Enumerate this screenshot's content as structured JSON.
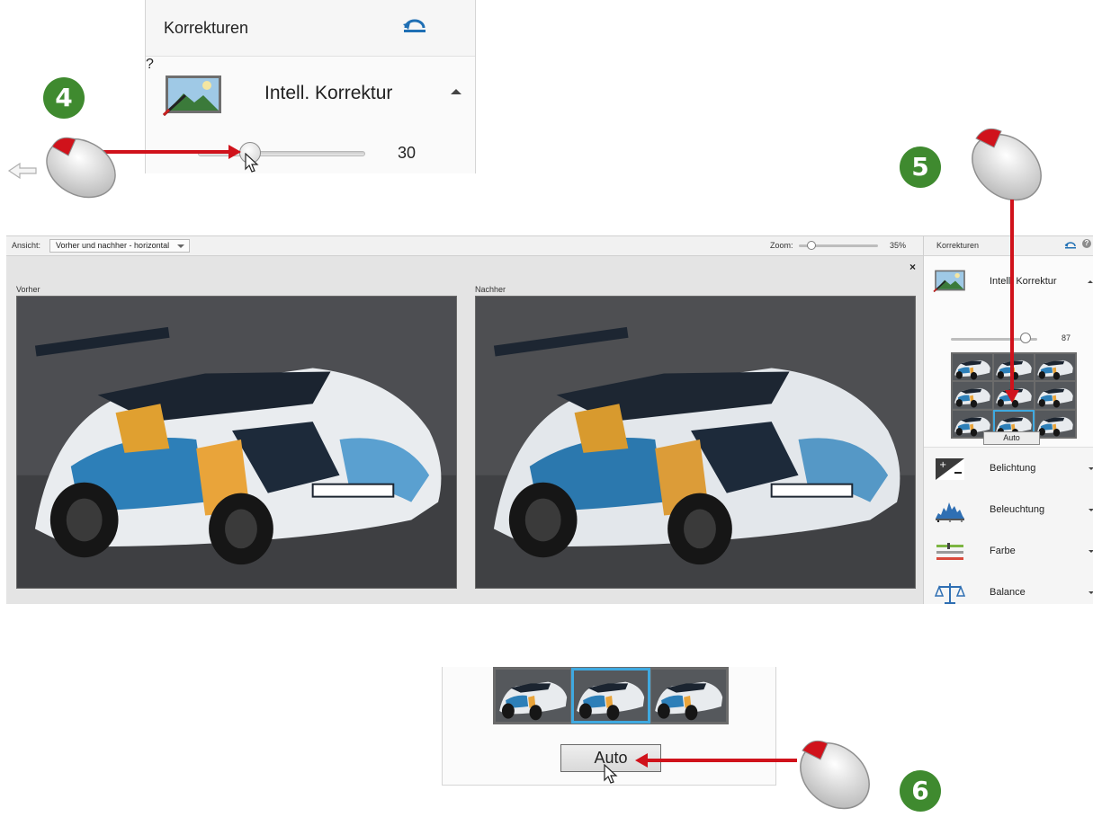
{
  "steps": [
    "4",
    "5",
    "6"
  ],
  "callout_top": {
    "panel_title": "Korrekturen",
    "feature_label": "Intell. Korrektur",
    "slider_value": "30",
    "slider_fraction": 0.3
  },
  "toolbar": {
    "view_label": "Ansicht:",
    "view_select": "Vorher und nachher - horizontal",
    "zoom_label": "Zoom:",
    "zoom_value": "35%"
  },
  "canvas": {
    "close_glyph": "×",
    "before_label": "Vorher",
    "after_label": "Nachher"
  },
  "right_panel": {
    "title": "Korrekturen",
    "smart_fix_label": "Intell. Korrektur",
    "slider_value": "87",
    "auto_label": "Auto",
    "selected_variation": 7,
    "items": [
      {
        "label": "Belichtung",
        "icon": "exposure-icon"
      },
      {
        "label": "Beleuchtung",
        "icon": "histogram-icon"
      },
      {
        "label": "Farbe",
        "icon": "color-icon"
      },
      {
        "label": "Balance",
        "icon": "balance-scale-icon"
      }
    ]
  },
  "callout_bottom": {
    "auto_label": "Auto"
  },
  "colors": {
    "step_badge": "#3f8a2f",
    "arrow_red": "#d0121b",
    "selection_blue": "#3fa9e0",
    "undo_blue": "#1f6fb4"
  }
}
